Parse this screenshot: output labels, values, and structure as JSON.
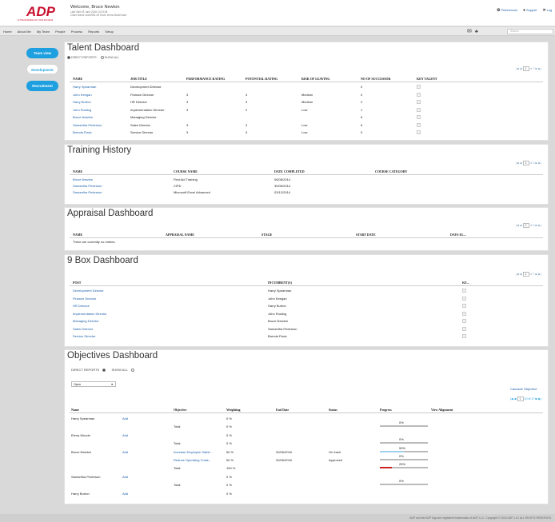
{
  "header": {
    "logo_text": "ADP",
    "logo_tag": "IN THE BUSINESS OF YOUR SUCCESS",
    "welcome": "Welcome, Bruce Newton",
    "last_visit": "Last Visit 03 June 2016 10:23:54",
    "client": "Client Name ctn00951-00 Kevin Demo Build team",
    "links": [
      {
        "icon": "gear-icon",
        "glyph": "⚙",
        "label": "Preferences"
      },
      {
        "icon": "chat-icon",
        "glyph": "●",
        "label": "Support"
      },
      {
        "icon": "close-icon",
        "glyph": "✕",
        "label": "Log"
      }
    ]
  },
  "nav": {
    "items": [
      "Home",
      "About Me",
      "My Team",
      "People",
      "Process",
      "Reports",
      "Setup"
    ],
    "search_placeholder": "Search"
  },
  "sidebar": {
    "team_view": "Team view",
    "development": "Development",
    "recruitment": "Recruitment"
  },
  "talent": {
    "title": "Talent Dashboard",
    "filter_direct": "DIRECT REPORTS",
    "filter_all": "SHOW ALL",
    "pager": {
      "page": "1",
      "of": "of",
      "total": "7"
    },
    "columns": [
      "NAME",
      "JOB TITLE",
      "PERFORMANCE RATING",
      "POTENTIAL RATING",
      "RISK OF LEAVING",
      "NO OF SUCCESSOR",
      "KEY TALENT"
    ],
    "rows": [
      [
        "Harry Spearman",
        "Development Director",
        "",
        "",
        "",
        "0"
      ],
      [
        "John Keegan",
        "Finance Director",
        "3",
        "3",
        "Medium",
        "0"
      ],
      [
        "Harry Burton",
        "HR Director",
        "3",
        "3",
        "Medium",
        "2"
      ],
      [
        "John Rusling",
        "Implementation Director",
        "3",
        "2",
        "Low",
        "1"
      ],
      [
        "Bruce Newton",
        "Managing Director",
        "",
        "",
        "",
        "6"
      ],
      [
        "Samantha Pederson",
        "Sales Director",
        "3",
        "3",
        "Low",
        "6"
      ],
      [
        "Brenda Flack",
        "Service Director",
        "3",
        "3",
        "Low",
        "0"
      ]
    ]
  },
  "training": {
    "title": "Training History",
    "pager": {
      "page": "1",
      "of": "of",
      "total": "3"
    },
    "columns": [
      "NAME",
      "COURSE NAME",
      "DATE COMPLETED",
      "COURSE CATEGORY"
    ],
    "rows": [
      [
        "Bruce Newton",
        "First Aid Training",
        "06/08/2014",
        ""
      ],
      [
        "Samantha Pederson",
        "CIPD",
        "30/06/2014",
        ""
      ],
      [
        "Samantha Pederson",
        "Microsoft Excel Advanced",
        "03/12/2014",
        ""
      ]
    ]
  },
  "appraisal": {
    "title": "Appraisal Dashboard",
    "pager": {
      "page": "0",
      "of": "of",
      "total": "0"
    },
    "columns": [
      "NAME",
      "APPRAISAL NAME",
      "STAGE",
      "START DATE",
      "DAYS EL..."
    ],
    "empty": "There are currently no entries."
  },
  "ninebox": {
    "title": "9 Box Dashboard",
    "pager": {
      "page": "1",
      "of": "of",
      "total": "7"
    },
    "columns": [
      "POST",
      "INCUMBENT(S)",
      "KE..."
    ],
    "rows": [
      [
        "Development Director",
        "Harry Spearman"
      ],
      [
        "Finance Director",
        "John Keegan"
      ],
      [
        "HR Director",
        "Harry Burton"
      ],
      [
        "Implementation Director",
        "John Rusling"
      ],
      [
        "Managing Director",
        "Bruce Newton"
      ],
      [
        "Sales Director",
        "Samantha Pederson"
      ],
      [
        "Service Director",
        "Brenda Flack"
      ]
    ]
  },
  "objectives": {
    "title": "Objectives Dashboard",
    "filter_direct": "DIRECT REPORTS",
    "filter_all": "SHOW ALL",
    "select_value": "Open",
    "cascade": "Cascade Objective",
    "pager": {
      "page": "1",
      "of": "10 of",
      "total": "17"
    },
    "columns": [
      "Name",
      "Objective",
      "Weighting",
      "End Date",
      "Status",
      "Progress",
      "View Alignment"
    ],
    "add_label": "Add",
    "total_label": "Total",
    "rows": [
      {
        "name": "Harry Spearman",
        "obj": "",
        "w": "0 %",
        "end": "",
        "status": "",
        "prog": null
      },
      {
        "name": "",
        "obj": "Total",
        "w": "0 %",
        "end": "",
        "status": "",
        "prog": {
          "label": "0%",
          "value": 0,
          "color": "#bbb"
        }
      },
      {
        "name": "Elena Woods",
        "obj": "",
        "w": "0 %",
        "end": "",
        "status": "",
        "prog": null
      },
      {
        "name": "",
        "obj": "Total",
        "w": "0 %",
        "end": "",
        "status": "",
        "prog": {
          "label": "0%",
          "value": 0,
          "color": "#bbb"
        }
      },
      {
        "name": "Bruce Newton",
        "obj": "Increase Employee Satisf...",
        "w": "50 %",
        "end": "30/06/2016",
        "status": "On track",
        "prog": {
          "label": "50%",
          "value": 50,
          "color": "#9fd0f0"
        }
      },
      {
        "name": "",
        "obj": "Reduce Operating Costs...",
        "w": "50 %",
        "end": "30/06/2016",
        "status": "Approved",
        "prog": {
          "label": "0%",
          "value": 0,
          "color": "#bbb"
        }
      },
      {
        "name": "",
        "obj": "Total",
        "w": "100 %",
        "end": "",
        "status": "",
        "prog": {
          "label": "25%",
          "value": 25,
          "color": "#cc2222"
        }
      },
      {
        "name": "Samantha Pederson",
        "obj": "",
        "w": "0 %",
        "end": "",
        "status": "",
        "prog": null
      },
      {
        "name": "",
        "obj": "Total",
        "w": "0 %",
        "end": "",
        "status": "",
        "prog": {
          "label": "0%",
          "value": 0,
          "color": "#bbb"
        }
      },
      {
        "name": "Harry Burton",
        "obj": "",
        "w": "0 %",
        "end": "",
        "status": "",
        "prog": null
      }
    ]
  },
  "footer": {
    "text": "ADP and the ADP logo are registered trademarks of ADP, LLC. Copyright © 2016 ADP, LLC ALL RIGHTS RESERVED."
  },
  "colors": {
    "accent": "#1ea0e0",
    "link": "#1a5ea8",
    "brand": "#c8102e"
  }
}
